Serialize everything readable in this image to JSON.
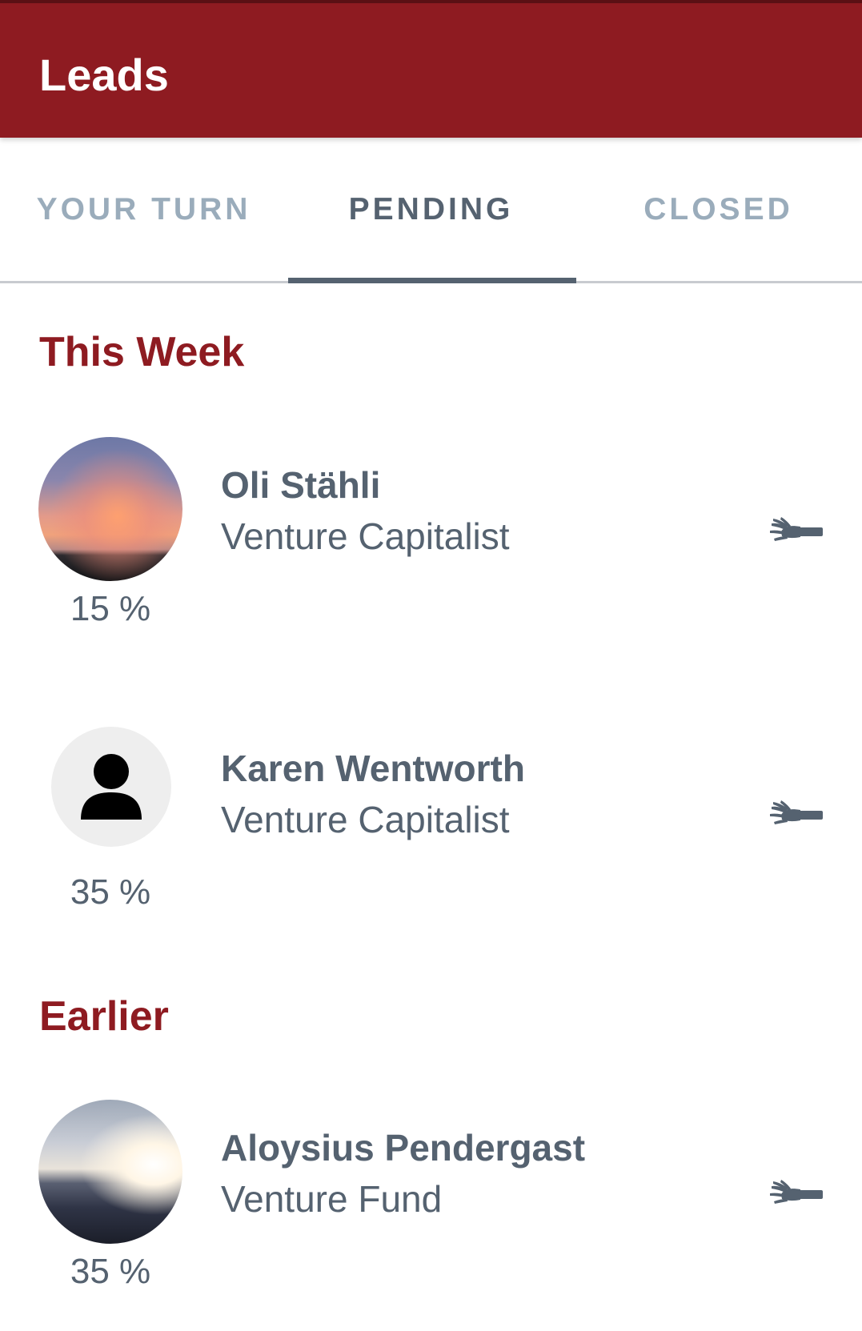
{
  "app_bar": {
    "title": "Leads"
  },
  "tabs": [
    {
      "label": "YOUR TURN",
      "active": false
    },
    {
      "label": "PENDING",
      "active": true
    },
    {
      "label": "CLOSED",
      "active": false
    }
  ],
  "sections": [
    {
      "title": "This Week",
      "leads": [
        {
          "name": "Oli Stähli",
          "role": "Venture Capitalist",
          "percent": "15 %",
          "avatar": "sunset-photo",
          "action_icon": "hand-icon"
        },
        {
          "name": "Karen Wentworth",
          "role": "Venture Capitalist",
          "percent": "35 %",
          "avatar": "person-placeholder-icon",
          "action_icon": "hand-icon"
        }
      ]
    },
    {
      "title": "Earlier",
      "leads": [
        {
          "name": "Aloysius Pendergast",
          "role": "Venture Fund",
          "percent": "35 %",
          "avatar": "dusk-photo",
          "action_icon": "hand-icon"
        }
      ]
    }
  ],
  "colors": {
    "primary": "#8e1b21",
    "text": "#556270",
    "tab_inactive": "#9aacbb"
  }
}
